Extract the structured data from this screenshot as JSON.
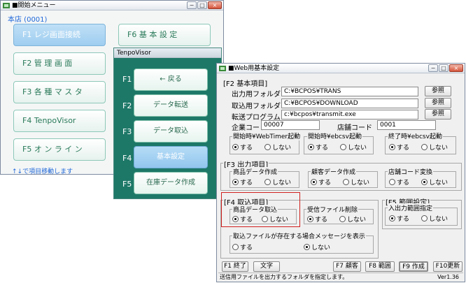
{
  "win1": {
    "title": "■開始メニュー",
    "store": "本店 (0001)",
    "buttons": [
      "F1 レジ画面接続",
      "F2 管 理 画 面",
      "F3 各 種 マ ス タ",
      "F4 TenpoVisor",
      "F5 オ ン ラ イ ン",
      "F6 基 本 設 定"
    ],
    "hint": "↑↓で項目移動します"
  },
  "win2": {
    "title": "TenpoVisor",
    "keys": [
      "F1",
      "F2",
      "F3",
      "F4",
      "F5"
    ],
    "buttons": [
      "← 戻る",
      "データ転送",
      "データ取込",
      "基本設定",
      "在庫データ作成"
    ]
  },
  "win3": {
    "title": "■Web用基本設定",
    "sec2": "[F2 基本項目]",
    "out_folder_label": "出力用フォルダ",
    "out_folder_value": "C:¥BCPOS¥TRANS",
    "in_folder_label": "取込用フォルダ",
    "in_folder_value": "C:¥BCPOS¥DOWNLOAD",
    "program_label": "転送プログラム",
    "program_value": "c:¥bcpos¥transmit.exe",
    "browse": "参照",
    "company_label": "企業コード",
    "company_value": "00007",
    "storecode_label": "店舗コード",
    "storecode_value": "0001",
    "g_webtimer": "開始時¥WebTimer起動",
    "g_ebcsv_start": "開始時¥ebcsv起動",
    "g_ebcsv_end": "終了時¥ebcsv起動",
    "sec3": "[F3 出力項目]",
    "g_product_out": "商品データ作成",
    "g_customer_out": "顧客データ作成",
    "g_storecode_conv": "店舗コード変換",
    "sec4": "[F4 取込項目]",
    "g_product_in": "商品データ取込",
    "g_receive_delete": "受信ファイル削除",
    "sec5": "[F5 範囲設定]",
    "g_io_range": "入出力範囲指定",
    "g_exists_msg": "取込ファイルが存在する場合メッセージを表示",
    "yes": "する",
    "no": "しない",
    "f1": "F1 終了",
    "text_btn": "文字",
    "f7": "F7 顧客",
    "f8": "F8 範囲",
    "f9": "F9 作成",
    "f10": "F10更新",
    "status": "送信用ファイルを出力するフォルダを指定します。",
    "version": "Ver1.36"
  }
}
